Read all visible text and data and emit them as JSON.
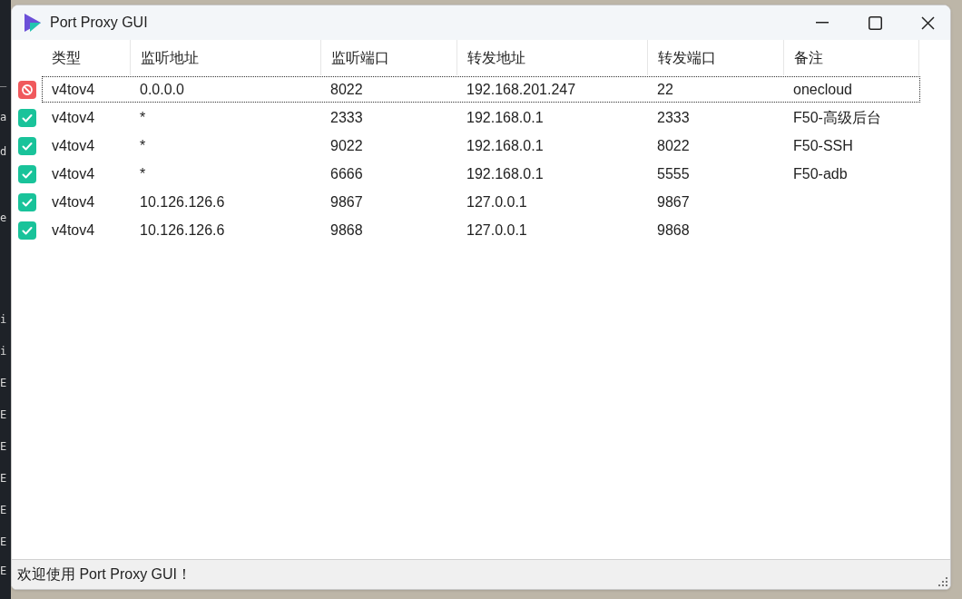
{
  "background": {
    "terminal_lines": [
      "_",
      "a",
      "d",
      "e",
      "i",
      "i",
      "E",
      "E",
      "E",
      "E",
      "E",
      "E",
      "E"
    ]
  },
  "window": {
    "title": "Port Proxy GUI"
  },
  "table": {
    "columns": [
      "类型",
      "监听地址",
      "监听端口",
      "转发地址",
      "转发端口",
      "备注"
    ],
    "rows": [
      {
        "enabled": false,
        "focused": true,
        "cells": [
          "v4tov4",
          "0.0.0.0",
          "8022",
          "192.168.201.247",
          "22",
          "onecloud"
        ]
      },
      {
        "enabled": true,
        "focused": false,
        "cells": [
          "v4tov4",
          "*",
          "2333",
          "192.168.0.1",
          "2333",
          "F50-高级后台"
        ]
      },
      {
        "enabled": true,
        "focused": false,
        "cells": [
          "v4tov4",
          "*",
          "9022",
          "192.168.0.1",
          "8022",
          "F50-SSH"
        ]
      },
      {
        "enabled": true,
        "focused": false,
        "cells": [
          "v4tov4",
          "*",
          "6666",
          "192.168.0.1",
          "5555",
          "F50-adb"
        ]
      },
      {
        "enabled": true,
        "focused": false,
        "cells": [
          "v4tov4",
          "10.126.126.6",
          "9867",
          "127.0.0.1",
          "9867",
          ""
        ]
      },
      {
        "enabled": true,
        "focused": false,
        "cells": [
          "v4tov4",
          "10.126.126.6",
          "9868",
          "127.0.0.1",
          "9868",
          ""
        ]
      }
    ]
  },
  "status_bar": {
    "text": "欢迎使用 Port Proxy GUI！"
  }
}
